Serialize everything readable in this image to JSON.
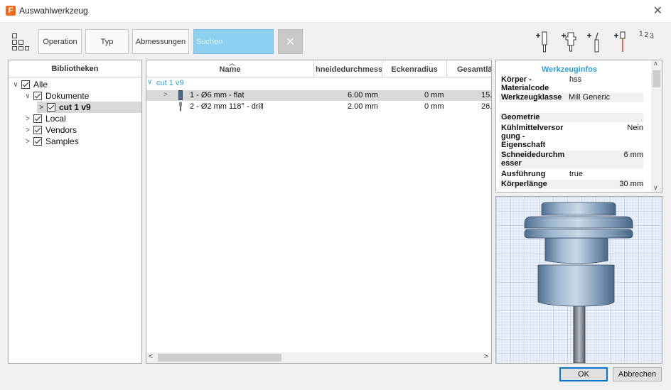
{
  "window": {
    "title": "Auswahlwerkzeug",
    "app_icon_letter": "F",
    "close_glyph": "✕"
  },
  "toolbar": {
    "operation_label": "Operation",
    "type_label": "Typ",
    "dimensions_label": "Abmessungen",
    "search_placeholder": "Suchen",
    "clear_glyph": "✕",
    "number_icon_text": "1 2 3"
  },
  "library": {
    "header": "Bibliotheken",
    "items": [
      {
        "label": "Alle",
        "arrow": "∨"
      },
      {
        "label": "Dokumente",
        "arrow": "∨"
      },
      {
        "label": "cut 1 v9",
        "arrow": ">"
      },
      {
        "label": "Local",
        "arrow": ">"
      },
      {
        "label": "Vendors",
        "arrow": ">"
      },
      {
        "label": "Samples",
        "arrow": ">"
      }
    ]
  },
  "grid": {
    "columns": [
      "Name",
      "hneidedurchmess",
      "Eckenradius",
      "Gesamtlä"
    ],
    "group_label": "cut 1 v9",
    "group_arrow": "∨",
    "rows": [
      {
        "arrow": ">",
        "name": "1 - Ø6 mm - flat",
        "diameter": "6.00 mm",
        "corner": "0 mm",
        "total": "15."
      },
      {
        "arrow": "",
        "name": "2 - Ø2 mm 118° - drill",
        "diameter": "2.00 mm",
        "corner": "0 mm",
        "total": "26."
      }
    ],
    "scroll_left": "<",
    "scroll_right": ">"
  },
  "info": {
    "title": "Werkzeuginfos",
    "rows": [
      {
        "key": "Körper -\nMaterialcode",
        "value": "hss"
      },
      {
        "key": "Werkzeugklasse",
        "value": "Mill Generic"
      },
      {
        "key": "",
        "value": ""
      },
      {
        "key": "Geometrie",
        "value": ""
      },
      {
        "key": "Kühlmittelversor\ngung -\nEigenschaft",
        "value": "Nein"
      },
      {
        "key": "Schneidedurchm\nesser",
        "value": "6 mm"
      },
      {
        "key": "Ausführung",
        "value": "true"
      },
      {
        "key": "Körperlänge",
        "value": "30 mm"
      }
    ],
    "scroll_up": "∧",
    "scroll_down": "∨"
  },
  "buttons": {
    "ok": "OK",
    "cancel": "Abbrechen"
  },
  "colors": {
    "accent": "#2a9fd8",
    "search_bg": "#8ed0f0",
    "app_icon": "#f26b1d"
  }
}
